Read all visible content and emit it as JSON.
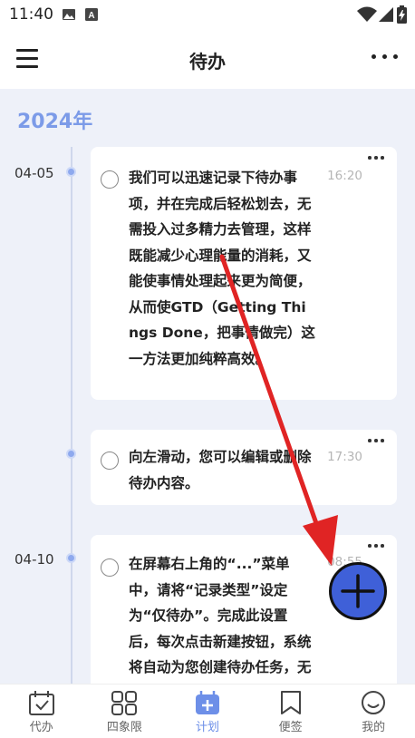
{
  "status_bar": {
    "time": "11:40",
    "icons": [
      "image-icon",
      "a-icon",
      "wifi-icon",
      "signal-icon",
      "battery-charging-icon"
    ]
  },
  "app_bar": {
    "title": "待办",
    "left_icon": "menu-icon",
    "right_icon": "more-icon"
  },
  "timeline": {
    "year": "2024年",
    "groups": [
      {
        "date": "04-05",
        "items": [
          {
            "text": "我们可以迅速记录下待办事项，并在完成后轻松划去，无需投入过多精力去管理，这样既能减少心理能量的消耗，又能使事情处理起来更为简便，从而使GTD（Getting Things Done，把事情做完）这一方法更加纯粹高效。",
            "time": "16:20"
          },
          {
            "text": "向左滑动，您可以编辑或删除待办内容。",
            "time": "17:30"
          }
        ]
      },
      {
        "date": "04-10",
        "items": [
          {
            "text": "在屏幕右上角的“...”菜单中，请将“记录类型”设定为“仅待办”。完成此设置后，每次点击新建按钮，系统将自动为您创建待办任务，无需再",
            "time": "08:55"
          }
        ]
      }
    ]
  },
  "fab": {
    "icon": "plus-icon"
  },
  "bottom_nav": {
    "items": [
      {
        "label": "代办",
        "icon": "calendar-check-icon",
        "active": false
      },
      {
        "label": "四象限",
        "icon": "grid-four-icon",
        "active": false
      },
      {
        "label": "计划",
        "icon": "calendar-plus-icon",
        "active": true
      },
      {
        "label": "便签",
        "icon": "bookmark-icon",
        "active": false
      },
      {
        "label": "我的",
        "icon": "smile-icon",
        "active": false
      }
    ]
  },
  "colors": {
    "accent": "#6d8fe8",
    "year": "#7c9be8",
    "background": "#eef1f9",
    "arrow": "#e02424",
    "fab": "#3f60d8"
  }
}
